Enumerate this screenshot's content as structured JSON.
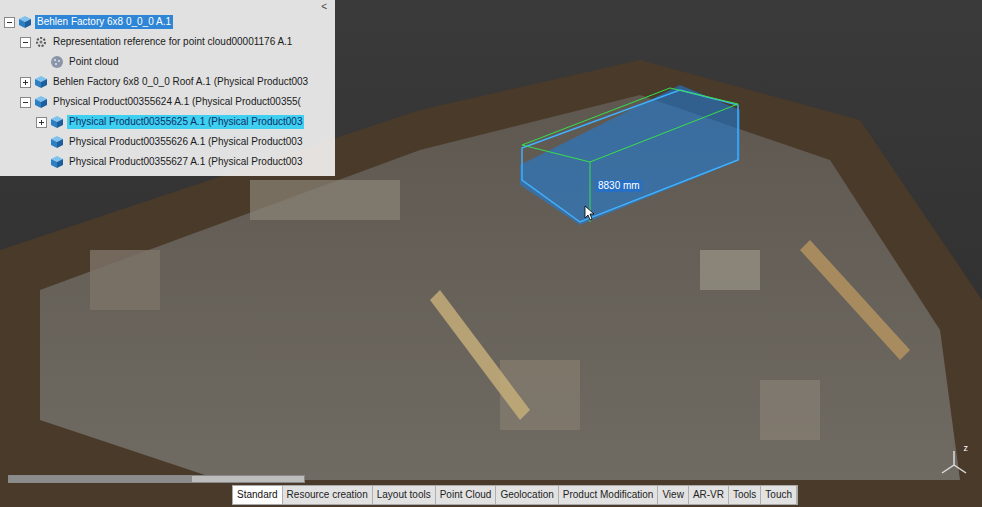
{
  "tree": {
    "collapse_button": "<",
    "items": [
      {
        "label": "Behlen Factory 6x8 0_0_0 A.1",
        "level": 0,
        "kind": "product",
        "has_children": true,
        "expanded": true,
        "selected": true,
        "hovered": false
      },
      {
        "label": "Representation reference for point cloud00001176 A.1",
        "level": 1,
        "kind": "representation",
        "has_children": true,
        "expanded": true,
        "selected": false,
        "hovered": false
      },
      {
        "label": "Point cloud",
        "level": 2,
        "kind": "pointcloud",
        "has_children": false,
        "expanded": false,
        "selected": false,
        "hovered": false
      },
      {
        "label": "Behlen Factory 6x8 0_0_0 Roof A.1 (Physical Product003",
        "level": 1,
        "kind": "product",
        "has_children": true,
        "expanded": false,
        "selected": false,
        "hovered": false
      },
      {
        "label": "Physical Product00355624 A.1 (Physical Product00355(",
        "level": 1,
        "kind": "product",
        "has_children": true,
        "expanded": true,
        "selected": false,
        "hovered": false
      },
      {
        "label": "Physical Product00355625 A.1 (Physical Product003",
        "level": 2,
        "kind": "product",
        "has_children": true,
        "expanded": false,
        "selected": false,
        "hovered": true
      },
      {
        "label": "Physical Product00355626 A.1 (Physical Product003",
        "level": 2,
        "kind": "product",
        "has_children": false,
        "expanded": false,
        "selected": false,
        "hovered": false
      },
      {
        "label": "Physical Product00355627 A.1 (Physical Product003",
        "level": 2,
        "kind": "product",
        "has_children": false,
        "expanded": false,
        "selected": false,
        "hovered": false
      }
    ]
  },
  "viewport": {
    "dimension_label": "8830 mm",
    "compass_label": "z"
  },
  "slider": {
    "level": 0.62
  },
  "tabs": [
    {
      "label": "Standard",
      "selected": true
    },
    {
      "label": "Resource creation",
      "selected": false
    },
    {
      "label": "Layout tools",
      "selected": false
    },
    {
      "label": "Point Cloud",
      "selected": false
    },
    {
      "label": "Geolocation",
      "selected": false
    },
    {
      "label": "Product Modification",
      "selected": false
    },
    {
      "label": "View",
      "selected": false
    },
    {
      "label": "AR-VR",
      "selected": false
    },
    {
      "label": "Tools",
      "selected": false
    },
    {
      "label": "Touch",
      "selected": false
    }
  ]
}
